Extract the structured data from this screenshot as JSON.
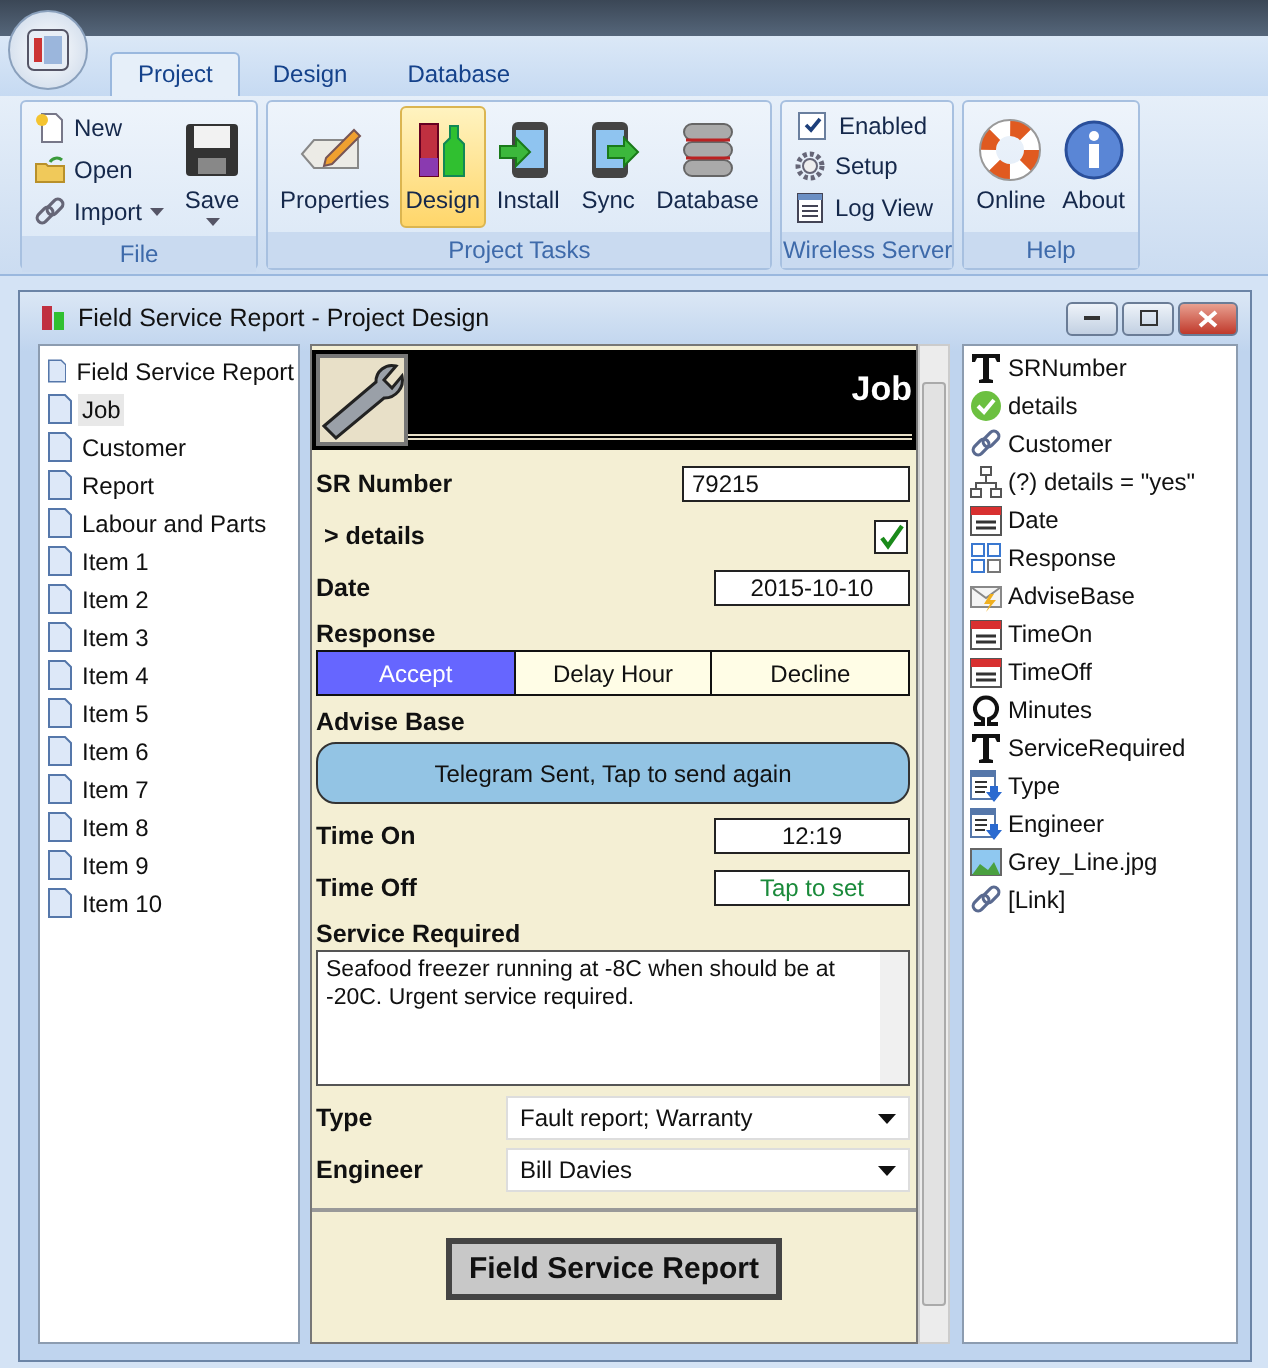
{
  "ribbon": {
    "tabs": [
      {
        "label": "Project",
        "selected": true
      },
      {
        "label": "Design",
        "selected": false
      },
      {
        "label": "Database",
        "selected": false
      }
    ],
    "groups": [
      {
        "title": "File",
        "small": [
          {
            "label": "New",
            "kind": "button"
          },
          {
            "label": "Open",
            "kind": "button"
          },
          {
            "label": "Import",
            "kind": "dropdown"
          }
        ],
        "large": [
          {
            "label": "Save",
            "dropdown": true,
            "selected": false
          }
        ]
      },
      {
        "title": "Project Tasks",
        "large": [
          {
            "label": "Properties",
            "dropdown": false,
            "selected": false
          },
          {
            "label": "Design",
            "dropdown": false,
            "selected": true
          },
          {
            "label": "Install",
            "dropdown": false,
            "selected": false
          },
          {
            "label": "Sync",
            "dropdown": false,
            "selected": false
          },
          {
            "label": "Database",
            "dropdown": false,
            "selected": false
          }
        ]
      },
      {
        "title": "Wireless Server",
        "small": [
          {
            "label": "Enabled",
            "kind": "checkbox",
            "checked": true
          },
          {
            "label": "Setup",
            "kind": "button"
          },
          {
            "label": "Log View",
            "kind": "button"
          }
        ]
      },
      {
        "title": "Help",
        "large": [
          {
            "label": "Online",
            "dropdown": false,
            "selected": false
          },
          {
            "label": "About",
            "dropdown": false,
            "selected": false
          }
        ]
      }
    ]
  },
  "window": {
    "title": "Field Service Report - Project Design"
  },
  "pages": [
    {
      "label": "Field Service Report",
      "selected": false
    },
    {
      "label": "Job",
      "selected": true
    },
    {
      "label": "Customer",
      "selected": false
    },
    {
      "label": "Report",
      "selected": false
    },
    {
      "label": "Labour and Parts",
      "selected": false
    },
    {
      "label": "Item 1",
      "selected": false
    },
    {
      "label": "Item 2",
      "selected": false
    },
    {
      "label": "Item 3",
      "selected": false
    },
    {
      "label": "Item 4",
      "selected": false
    },
    {
      "label": "Item 5",
      "selected": false
    },
    {
      "label": "Item 6",
      "selected": false
    },
    {
      "label": "Item 7",
      "selected": false
    },
    {
      "label": "Item 8",
      "selected": false
    },
    {
      "label": "Item 9",
      "selected": false
    },
    {
      "label": "Item 10",
      "selected": false
    }
  ],
  "form": {
    "title": "Job",
    "fields": [
      {
        "kind": "text",
        "label": "SR Number",
        "value": "79215"
      },
      {
        "kind": "check",
        "label": "> details",
        "checked": true
      },
      {
        "kind": "date",
        "label": "Date",
        "value": "2015-10-10"
      },
      {
        "kind": "segments",
        "label": "Response",
        "options": [
          {
            "label": "Accept",
            "selected": true
          },
          {
            "label": "Delay Hour",
            "selected": false
          },
          {
            "label": "Decline",
            "selected": false
          }
        ]
      },
      {
        "kind": "action",
        "label": "Advise Base",
        "button": "Telegram Sent, Tap to send again"
      },
      {
        "kind": "date",
        "label": "Time On",
        "value": "12:19"
      },
      {
        "kind": "date",
        "label": "Time Off",
        "placeholder": "Tap to set"
      },
      {
        "kind": "memo",
        "label": "Service Required",
        "value": "Seafood freezer running at -8C when should be at -20C. Urgent service required."
      },
      {
        "kind": "dropdown",
        "label": "Type",
        "value": "Fault report; Warranty"
      },
      {
        "kind": "dropdown",
        "label": "Engineer",
        "value": "Bill Davies"
      }
    ],
    "footer_button": "Field Service Report"
  },
  "elements": [
    {
      "kind": "text",
      "label": "SRNumber"
    },
    {
      "kind": "check",
      "label": "details"
    },
    {
      "kind": "link",
      "label": "Customer"
    },
    {
      "kind": "condition",
      "label": "(?) details = \"yes\""
    },
    {
      "kind": "date",
      "label": "Date"
    },
    {
      "kind": "choice",
      "label": "Response"
    },
    {
      "kind": "message",
      "label": "AdviseBase"
    },
    {
      "kind": "date",
      "label": "TimeOn"
    },
    {
      "kind": "date",
      "label": "TimeOff"
    },
    {
      "kind": "formula",
      "label": "Minutes"
    },
    {
      "kind": "text",
      "label": "ServiceRequired"
    },
    {
      "kind": "list",
      "label": "Type"
    },
    {
      "kind": "list",
      "label": "Engineer"
    },
    {
      "kind": "image",
      "label": "Grey_Line.jpg"
    },
    {
      "kind": "link",
      "label": "[Link]"
    }
  ]
}
